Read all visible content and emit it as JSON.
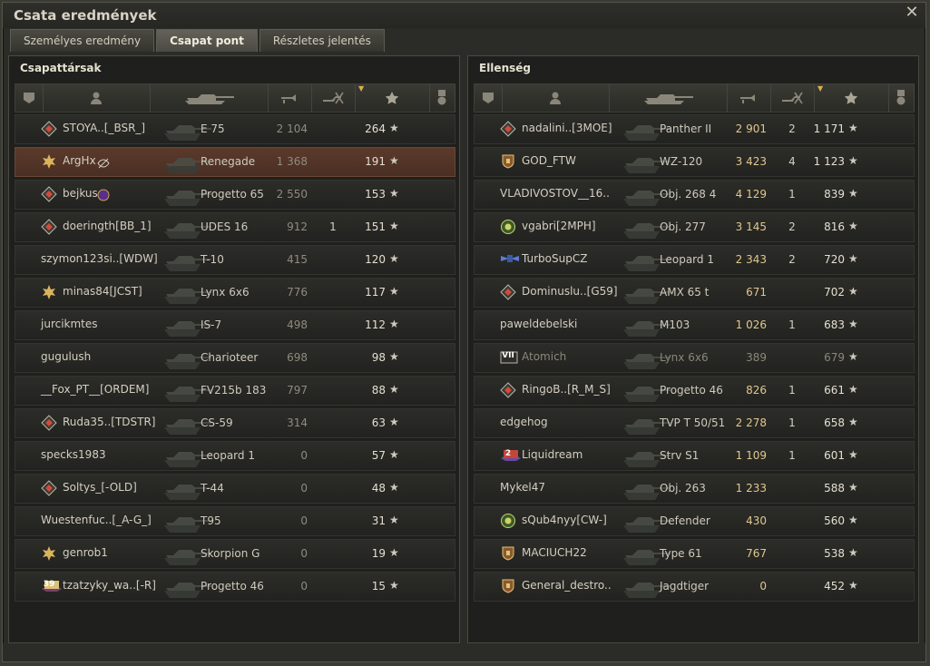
{
  "window": {
    "title": "Csata eredmények",
    "close_symbol": "✕"
  },
  "tabs": [
    {
      "label": "Személyes eredmény",
      "active": false
    },
    {
      "label": "Csapat pont",
      "active": true
    },
    {
      "label": "Részletes jelentés",
      "active": false
    }
  ],
  "columns": [
    {
      "key": "rank",
      "icon": "rank-column-icon"
    },
    {
      "key": "player",
      "icon": "player-column-icon"
    },
    {
      "key": "vehicle",
      "icon": "tank-column-icon"
    },
    {
      "key": "damage",
      "icon": "damage-column-icon"
    },
    {
      "key": "kills",
      "icon": "kills-column-icon"
    },
    {
      "key": "xp",
      "icon": "star-column-icon",
      "sorted": true
    },
    {
      "key": "medals",
      "icon": "medal-column-icon"
    }
  ],
  "star_symbol": "★",
  "left": {
    "title": "Csapattársak",
    "rows": [
      {
        "name": "STOYA..[_BSR_]",
        "badge": "rank-badge-icon",
        "vehicle": "E 75",
        "damage": "2 104",
        "kills": "",
        "xp": "264",
        "style": "normal"
      },
      {
        "name": "ArgHx",
        "badge": "gold-emblem-icon",
        "extra": "eye-icon",
        "vehicle": "Renegade",
        "damage": "1 368",
        "kills": "",
        "xp": "191",
        "style": "highlight"
      },
      {
        "name": "bejkus",
        "badge": "rank-badge-icon",
        "extra": "clan-badge-icon",
        "vehicle": "Progetto 65",
        "damage": "2 550",
        "kills": "",
        "xp": "153",
        "style": "normal"
      },
      {
        "name": "doeringth[BB_1]",
        "badge": "rank-badge-icon",
        "vehicle": "UDES 16",
        "damage": "912",
        "kills": "1",
        "xp": "151",
        "style": "normal"
      },
      {
        "name": "szymon123si..[WDW]",
        "badge": "",
        "vehicle": "T-10",
        "damage": "415",
        "kills": "",
        "xp": "120",
        "style": "normal"
      },
      {
        "name": "minas84[JCST]",
        "badge": "gold-emblem-icon",
        "vehicle": "Lynx 6x6",
        "damage": "776",
        "kills": "",
        "xp": "117",
        "style": "normal"
      },
      {
        "name": "jurcikmtes",
        "badge": "",
        "vehicle": "IS-7",
        "damage": "498",
        "kills": "",
        "xp": "112",
        "style": "normal"
      },
      {
        "name": "gugulush",
        "badge": "",
        "vehicle": "Charioteer",
        "damage": "698",
        "kills": "",
        "xp": "98",
        "style": "normal"
      },
      {
        "name": "__Fox_PT__[ORDEM]",
        "badge": "",
        "vehicle": "FV215b 183",
        "damage": "797",
        "kills": "",
        "xp": "88",
        "style": "normal"
      },
      {
        "name": "Ruda35..[TDSTR]",
        "badge": "rank-badge-icon",
        "vehicle": "CS-59",
        "damage": "314",
        "kills": "",
        "xp": "63",
        "style": "normal"
      },
      {
        "name": "specks1983",
        "badge": "",
        "vehicle": "Leopard 1",
        "damage": "0",
        "kills": "",
        "xp": "57",
        "style": "normal"
      },
      {
        "name": "Soltys_[-OLD]",
        "badge": "rank-badge-icon",
        "vehicle": "T-44",
        "damage": "0",
        "kills": "",
        "xp": "48",
        "style": "normal"
      },
      {
        "name": "Wuestenfuc..[_A-G_]",
        "badge": "",
        "vehicle": "T95",
        "damage": "0",
        "kills": "",
        "xp": "31",
        "style": "normal"
      },
      {
        "name": "genrob1",
        "badge": "gold-emblem-icon",
        "vehicle": "Skorpion G",
        "damage": "0",
        "kills": "",
        "xp": "19",
        "style": "normal"
      },
      {
        "name": "tzatzyky_wa..[-R]",
        "badge": "level-39-badge-icon",
        "badge_text": "39",
        "vehicle": "Progetto 46",
        "damage": "0",
        "kills": "",
        "xp": "15",
        "style": "normal"
      }
    ]
  },
  "right": {
    "title": "Ellenség",
    "rows": [
      {
        "name": "nadalini..[3MOE]",
        "badge": "rank-badge-icon",
        "vehicle": "Panther II",
        "damage": "2 901",
        "kills": "2",
        "xp": "1 171",
        "style": "normal"
      },
      {
        "name": "GOD_FTW",
        "badge": "shield-badge-icon",
        "vehicle": "WZ-120",
        "damage": "3 423",
        "kills": "4",
        "xp": "1 123",
        "style": "normal"
      },
      {
        "name": "VLADIVOSTOV__16..",
        "badge": "",
        "vehicle": "Obj. 268 4",
        "damage": "4 129",
        "kills": "1",
        "xp": "839",
        "style": "normal"
      },
      {
        "name": "vgabri[2MPH]",
        "badge": "green-emblem-icon",
        "vehicle": "Obj. 277",
        "damage": "3 145",
        "kills": "2",
        "xp": "816",
        "style": "normal"
      },
      {
        "name": "TurboSupCZ",
        "badge": "wings-badge-icon",
        "vehicle": "Leopard 1",
        "damage": "2 343",
        "kills": "2",
        "xp": "720",
        "style": "normal"
      },
      {
        "name": "Dominuslu..[G59]",
        "badge": "rank-badge-icon",
        "vehicle": "AMX 65 t",
        "damage": "671",
        "kills": "",
        "xp": "702",
        "style": "normal"
      },
      {
        "name": "paweldebelski",
        "badge": "",
        "vehicle": "M103",
        "damage": "1 026",
        "kills": "1",
        "xp": "683",
        "style": "normal"
      },
      {
        "name": "Atomich",
        "badge": "level-7-badge-icon",
        "badge_text": "VII",
        "vehicle": "Lynx 6x6",
        "damage": "389",
        "kills": "",
        "xp": "679",
        "style": "dim"
      },
      {
        "name": "RingoB..[R_M_S]",
        "badge": "rank-badge-icon",
        "vehicle": "Progetto 46",
        "damage": "826",
        "kills": "1",
        "xp": "661",
        "style": "normal"
      },
      {
        "name": "edgehog",
        "badge": "",
        "vehicle": "TVP T 50/51",
        "damage": "2 278",
        "kills": "1",
        "xp": "658",
        "style": "normal"
      },
      {
        "name": "Liquidream",
        "badge": "level-2-badge-icon",
        "badge_text": "2",
        "vehicle": "Strv S1",
        "damage": "1 109",
        "kills": "1",
        "xp": "601",
        "style": "normal"
      },
      {
        "name": "Mykel47",
        "badge": "",
        "vehicle": "Obj. 263",
        "damage": "1 233",
        "kills": "",
        "xp": "588",
        "style": "normal"
      },
      {
        "name": "sQub4nyy[CW-]",
        "badge": "green-emblem-icon",
        "vehicle": "Defender",
        "damage": "430",
        "kills": "",
        "xp": "560",
        "style": "normal"
      },
      {
        "name": "MACIUCH22",
        "badge": "shield-badge-icon",
        "vehicle": "Type 61",
        "damage": "767",
        "kills": "",
        "xp": "538",
        "style": "normal"
      },
      {
        "name": "General_destro..",
        "badge": "shield-badge-icon",
        "vehicle": "Jagdtiger",
        "damage": "0",
        "kills": "",
        "xp": "452",
        "style": "normal"
      }
    ]
  }
}
